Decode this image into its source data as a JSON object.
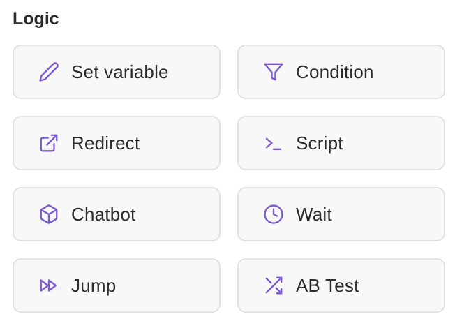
{
  "section": {
    "title": "Logic"
  },
  "accent_color": "#7c5ad6",
  "blocks": [
    {
      "label": "Set variable",
      "icon": "pencil-icon"
    },
    {
      "label": "Condition",
      "icon": "filter-icon"
    },
    {
      "label": "Redirect",
      "icon": "external-link-icon"
    },
    {
      "label": "Script",
      "icon": "terminal-icon"
    },
    {
      "label": "Chatbot",
      "icon": "cube-icon"
    },
    {
      "label": "Wait",
      "icon": "clock-icon"
    },
    {
      "label": "Jump",
      "icon": "fast-forward-icon"
    },
    {
      "label": "AB Test",
      "icon": "shuffle-icon"
    }
  ]
}
